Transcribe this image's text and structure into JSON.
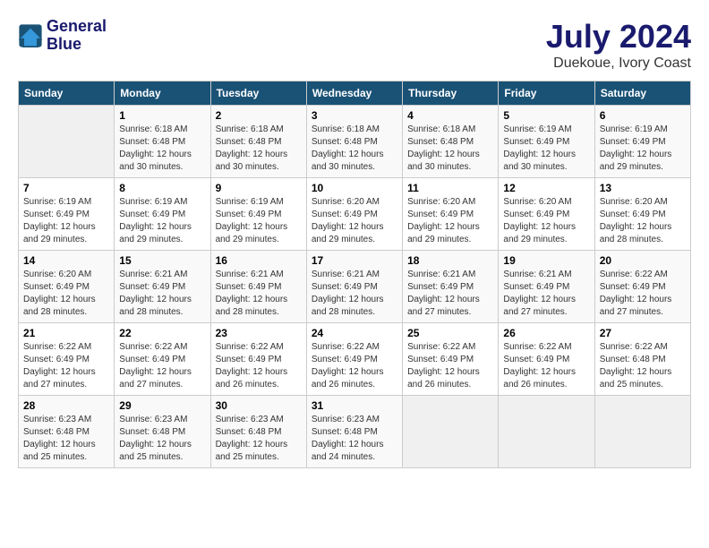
{
  "header": {
    "logo_line1": "General",
    "logo_line2": "Blue",
    "main_title": "July 2024",
    "subtitle": "Duekoue, Ivory Coast"
  },
  "days_of_week": [
    "Sunday",
    "Monday",
    "Tuesday",
    "Wednesday",
    "Thursday",
    "Friday",
    "Saturday"
  ],
  "weeks": [
    [
      {
        "num": "",
        "info": ""
      },
      {
        "num": "1",
        "info": "Sunrise: 6:18 AM\nSunset: 6:48 PM\nDaylight: 12 hours\nand 30 minutes."
      },
      {
        "num": "2",
        "info": "Sunrise: 6:18 AM\nSunset: 6:48 PM\nDaylight: 12 hours\nand 30 minutes."
      },
      {
        "num": "3",
        "info": "Sunrise: 6:18 AM\nSunset: 6:48 PM\nDaylight: 12 hours\nand 30 minutes."
      },
      {
        "num": "4",
        "info": "Sunrise: 6:18 AM\nSunset: 6:48 PM\nDaylight: 12 hours\nand 30 minutes."
      },
      {
        "num": "5",
        "info": "Sunrise: 6:19 AM\nSunset: 6:49 PM\nDaylight: 12 hours\nand 30 minutes."
      },
      {
        "num": "6",
        "info": "Sunrise: 6:19 AM\nSunset: 6:49 PM\nDaylight: 12 hours\nand 29 minutes."
      }
    ],
    [
      {
        "num": "7",
        "info": "Sunrise: 6:19 AM\nSunset: 6:49 PM\nDaylight: 12 hours\nand 29 minutes."
      },
      {
        "num": "8",
        "info": "Sunrise: 6:19 AM\nSunset: 6:49 PM\nDaylight: 12 hours\nand 29 minutes."
      },
      {
        "num": "9",
        "info": "Sunrise: 6:19 AM\nSunset: 6:49 PM\nDaylight: 12 hours\nand 29 minutes."
      },
      {
        "num": "10",
        "info": "Sunrise: 6:20 AM\nSunset: 6:49 PM\nDaylight: 12 hours\nand 29 minutes."
      },
      {
        "num": "11",
        "info": "Sunrise: 6:20 AM\nSunset: 6:49 PM\nDaylight: 12 hours\nand 29 minutes."
      },
      {
        "num": "12",
        "info": "Sunrise: 6:20 AM\nSunset: 6:49 PM\nDaylight: 12 hours\nand 29 minutes."
      },
      {
        "num": "13",
        "info": "Sunrise: 6:20 AM\nSunset: 6:49 PM\nDaylight: 12 hours\nand 28 minutes."
      }
    ],
    [
      {
        "num": "14",
        "info": "Sunrise: 6:20 AM\nSunset: 6:49 PM\nDaylight: 12 hours\nand 28 minutes."
      },
      {
        "num": "15",
        "info": "Sunrise: 6:21 AM\nSunset: 6:49 PM\nDaylight: 12 hours\nand 28 minutes."
      },
      {
        "num": "16",
        "info": "Sunrise: 6:21 AM\nSunset: 6:49 PM\nDaylight: 12 hours\nand 28 minutes."
      },
      {
        "num": "17",
        "info": "Sunrise: 6:21 AM\nSunset: 6:49 PM\nDaylight: 12 hours\nand 28 minutes."
      },
      {
        "num": "18",
        "info": "Sunrise: 6:21 AM\nSunset: 6:49 PM\nDaylight: 12 hours\nand 27 minutes."
      },
      {
        "num": "19",
        "info": "Sunrise: 6:21 AM\nSunset: 6:49 PM\nDaylight: 12 hours\nand 27 minutes."
      },
      {
        "num": "20",
        "info": "Sunrise: 6:22 AM\nSunset: 6:49 PM\nDaylight: 12 hours\nand 27 minutes."
      }
    ],
    [
      {
        "num": "21",
        "info": "Sunrise: 6:22 AM\nSunset: 6:49 PM\nDaylight: 12 hours\nand 27 minutes."
      },
      {
        "num": "22",
        "info": "Sunrise: 6:22 AM\nSunset: 6:49 PM\nDaylight: 12 hours\nand 27 minutes."
      },
      {
        "num": "23",
        "info": "Sunrise: 6:22 AM\nSunset: 6:49 PM\nDaylight: 12 hours\nand 26 minutes."
      },
      {
        "num": "24",
        "info": "Sunrise: 6:22 AM\nSunset: 6:49 PM\nDaylight: 12 hours\nand 26 minutes."
      },
      {
        "num": "25",
        "info": "Sunrise: 6:22 AM\nSunset: 6:49 PM\nDaylight: 12 hours\nand 26 minutes."
      },
      {
        "num": "26",
        "info": "Sunrise: 6:22 AM\nSunset: 6:49 PM\nDaylight: 12 hours\nand 26 minutes."
      },
      {
        "num": "27",
        "info": "Sunrise: 6:22 AM\nSunset: 6:48 PM\nDaylight: 12 hours\nand 25 minutes."
      }
    ],
    [
      {
        "num": "28",
        "info": "Sunrise: 6:23 AM\nSunset: 6:48 PM\nDaylight: 12 hours\nand 25 minutes."
      },
      {
        "num": "29",
        "info": "Sunrise: 6:23 AM\nSunset: 6:48 PM\nDaylight: 12 hours\nand 25 minutes."
      },
      {
        "num": "30",
        "info": "Sunrise: 6:23 AM\nSunset: 6:48 PM\nDaylight: 12 hours\nand 25 minutes."
      },
      {
        "num": "31",
        "info": "Sunrise: 6:23 AM\nSunset: 6:48 PM\nDaylight: 12 hours\nand 24 minutes."
      },
      {
        "num": "",
        "info": ""
      },
      {
        "num": "",
        "info": ""
      },
      {
        "num": "",
        "info": ""
      }
    ]
  ]
}
